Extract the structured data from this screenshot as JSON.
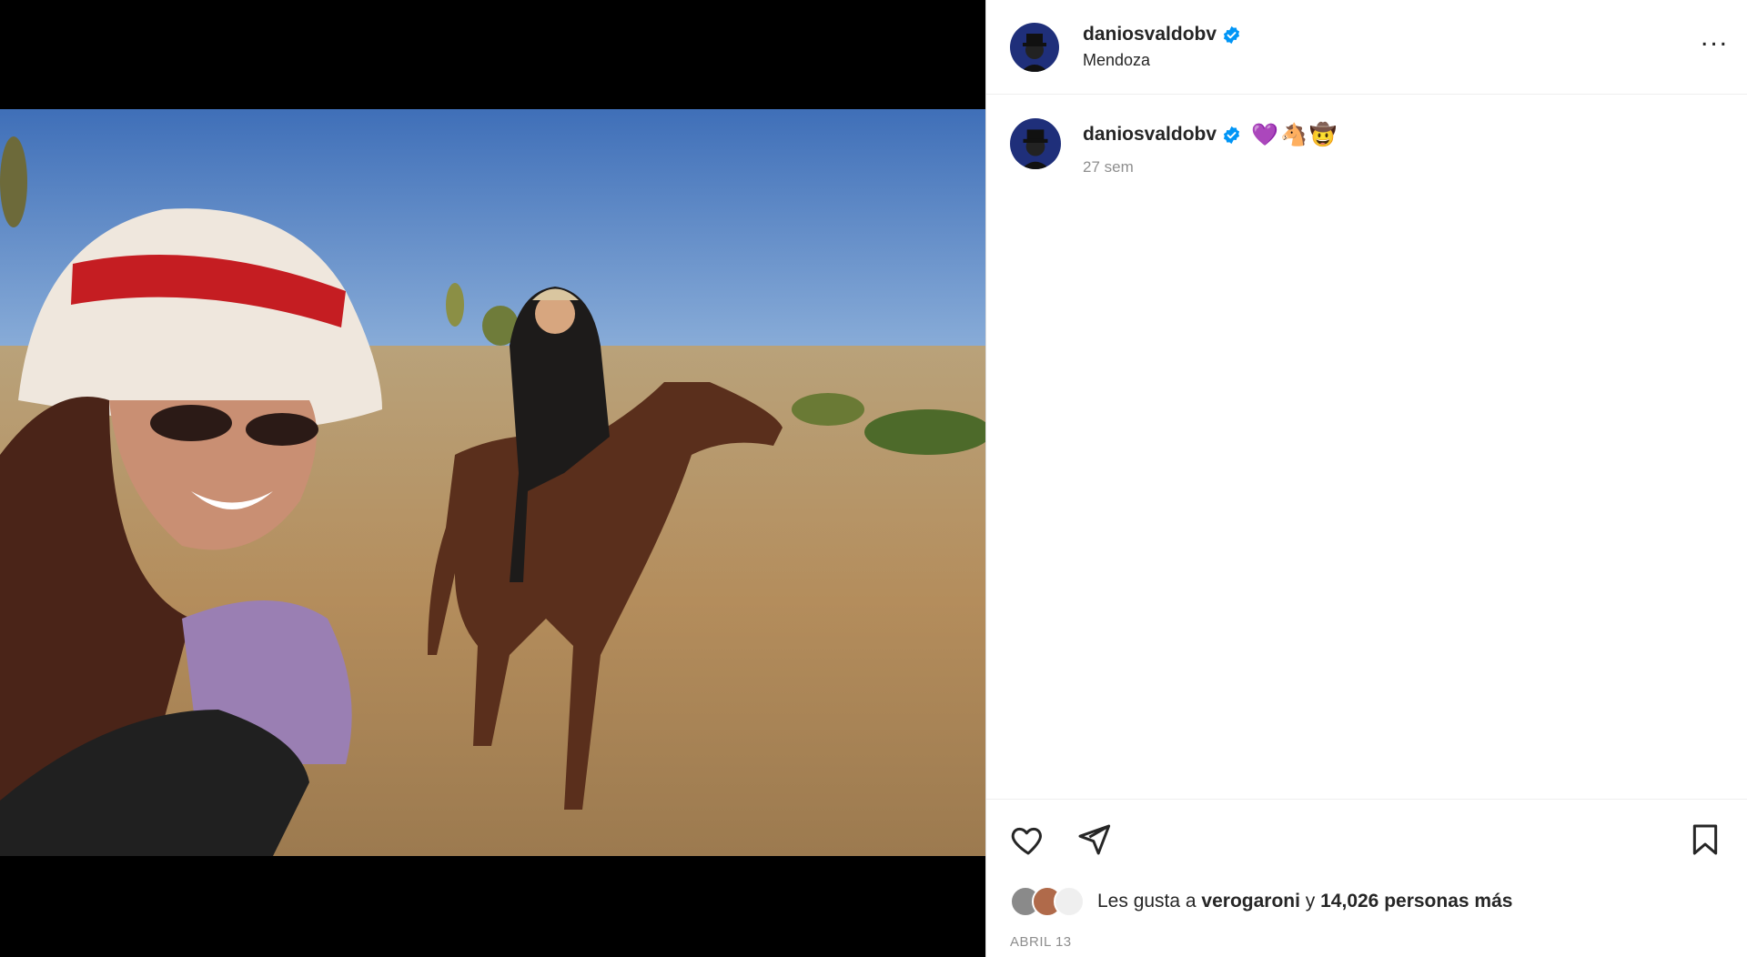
{
  "post": {
    "username": "daniosvaldobv",
    "location": "Mendoza",
    "more_label": "...",
    "caption_emojis": [
      "💜",
      "🐴",
      "🤠"
    ],
    "time_ago": "27 sem",
    "likes_prefix": "Les gusta a ",
    "liked_by": "verogaroni",
    "likes_connector": " y ",
    "likes_count": "14,026 personas más",
    "date": "ABRIL 13"
  },
  "colors": {
    "verified_blue": "#0095f6",
    "text_primary": "#262626",
    "text_secondary": "#8e8e8e"
  },
  "icons": {
    "like": "heart-icon",
    "share": "send-icon",
    "save": "bookmark-icon",
    "verified": "verified-badge-icon",
    "more": "more-options-icon"
  }
}
